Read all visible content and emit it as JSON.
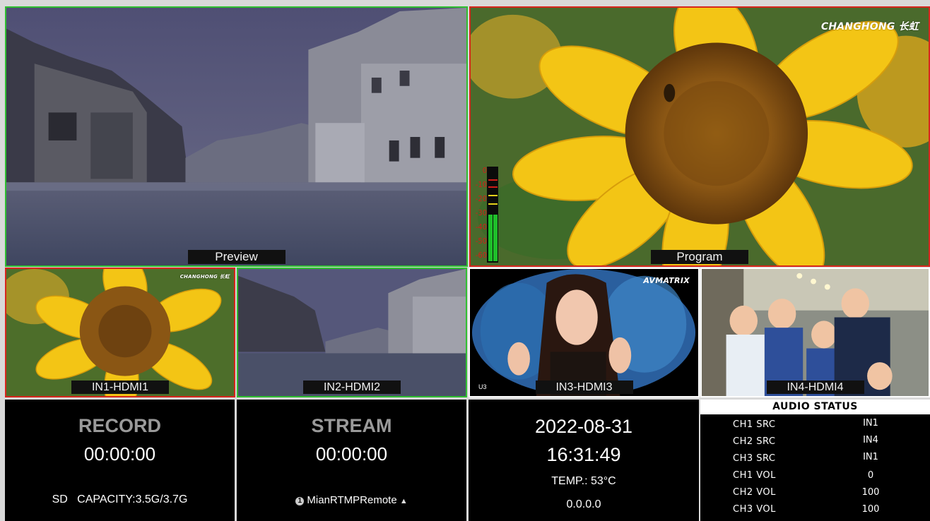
{
  "tiles": {
    "preview": {
      "label": "Preview"
    },
    "program": {
      "label": "Program",
      "logo": "CHANGHONG 长虹"
    },
    "in1": {
      "label": "IN1-HDMI1",
      "logo": "CHANGHONG 长虹"
    },
    "in2": {
      "label": "IN2-HDMI2"
    },
    "in3": {
      "label": "IN3-HDMI3",
      "logo": "AVMATRIX",
      "corner_text": "U3"
    },
    "in4": {
      "label": "IN4-HDMI4"
    }
  },
  "vu_meter": {
    "scale": [
      "0",
      "-10",
      "-20",
      "-30",
      "-40",
      "-50",
      "-60"
    ],
    "level_db": -30,
    "colors": {
      "green": "#1fbf2a",
      "yellow": "#e6d21a",
      "red": "#d21d18"
    }
  },
  "record": {
    "title": "RECORD",
    "timer": "00:00:00",
    "capacity": "SD   CAPACITY:3.5G/3.7G"
  },
  "stream": {
    "title": "STREAM",
    "timer": "00:00:00",
    "status_icon": "info-circle-icon",
    "name": "MianRTMPRemote",
    "arrow_icon": "upload-arrow-icon"
  },
  "system": {
    "date": "2022-08-31",
    "time": "16:31:49",
    "temp": "TEMP.: 53°C",
    "ip": "0.0.0.0"
  },
  "audio": {
    "title": "AUDIO STATUS",
    "rows": [
      {
        "key": "CH1 SRC",
        "value": "IN1"
      },
      {
        "key": "CH2 SRC",
        "value": "IN4"
      },
      {
        "key": "CH3 SRC",
        "value": "IN1"
      },
      {
        "key": "CH1 VOL",
        "value": "0"
      },
      {
        "key": "CH2 VOL",
        "value": "100"
      },
      {
        "key": "CH3 VOL",
        "value": "100"
      }
    ]
  },
  "colors": {
    "preview_border": "#2fbf31",
    "program_border": "#d7261d"
  }
}
